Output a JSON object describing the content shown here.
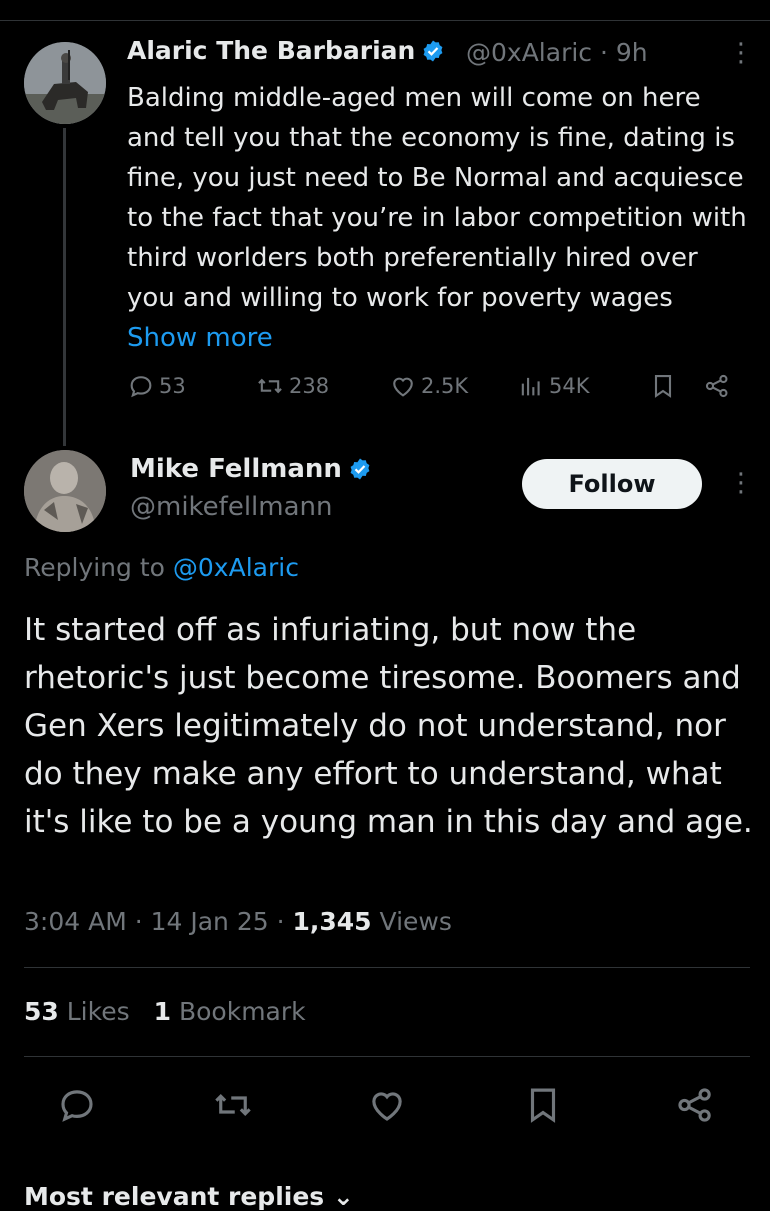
{
  "parent": {
    "author_name": "Alaric The Barbarian",
    "meta": "@0xAlaric · 9h",
    "text": "Balding middle-aged men will come on here and tell you that the economy is fine, dating is fine, you just need to Be Normal and acquiesce to the fact that you’re in labor competition with third worlders both preferentially hired over you and willing to work for poverty wages",
    "show_more": "Show more",
    "replies": "53",
    "reposts": "238",
    "likes": "2.5K",
    "views": "54K"
  },
  "reply": {
    "author_name": "Mike Fellmann",
    "handle": "@mikefellmann",
    "follow_label": "Follow",
    "replying_prefix": "Replying to",
    "replying_to": "@0xAlaric",
    "text": "It started off as infuriating, but now the rhetoric's just become tiresome. Boomers and Gen Xers legitimately do not understand, nor do they make any effort to understand, what it's like to be a young man in this day and age.",
    "time": "3:04 AM · 14 Jan 25 · ",
    "views_count": "1,345",
    "views_label": " Views",
    "likes_count": "53",
    "likes_label": " Likes",
    "bookmarks_count": "1",
    "bookmarks_label": " Bookmark"
  },
  "footer": {
    "more_replies": "Most relevant replies ⌄"
  },
  "colors": {
    "background": "#000000",
    "text": "#e7e9ea",
    "muted": "#71767b",
    "accent": "#1d9bf0",
    "divider": "#2f3336"
  },
  "icons": [
    "verified-badge-icon",
    "more-options-icon",
    "reply-icon",
    "repost-icon",
    "like-icon",
    "views-icon",
    "bookmark-icon",
    "share-icon"
  ]
}
